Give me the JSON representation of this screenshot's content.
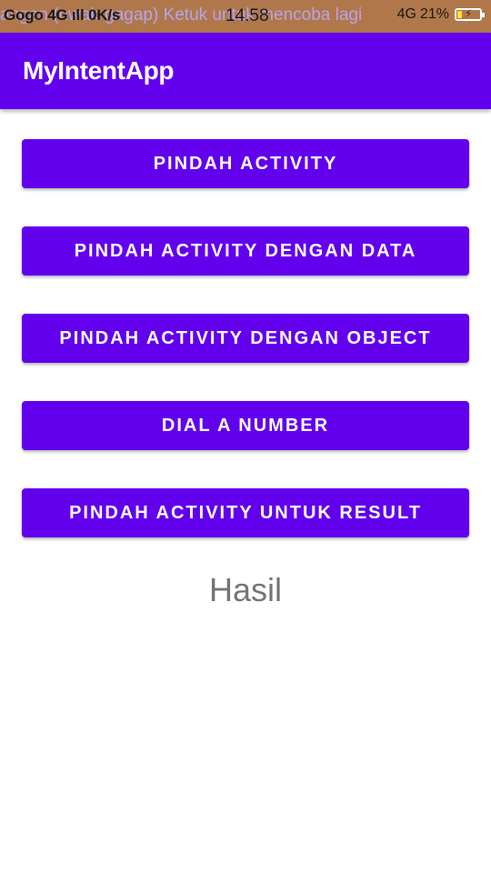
{
  "status_bar": {
    "carrier_info": "Gogo 4G ıll 0K/s",
    "ticker": "angan (nwak-gagap) Ketuk untuk mencoba lagi",
    "clock": "14.58",
    "network": "4G",
    "battery_percent": "21%",
    "battery_level": 0.21
  },
  "app_bar": {
    "title": "MyIntentApp"
  },
  "buttons": [
    {
      "label": "PINDAH ACTIVITY"
    },
    {
      "label": "PINDAH ACTIVITY DENGAN DATA"
    },
    {
      "label": "PINDAH ACTIVITY DENGAN OBJECT"
    },
    {
      "label": "DIAL A NUMBER"
    },
    {
      "label": "PINDAH ACTIVITY UNTUK RESULT"
    }
  ],
  "result": {
    "text": "Hasil"
  },
  "colors": {
    "primary": "#6200ee",
    "status_bar": "#b0784a",
    "result_text": "#757575"
  }
}
